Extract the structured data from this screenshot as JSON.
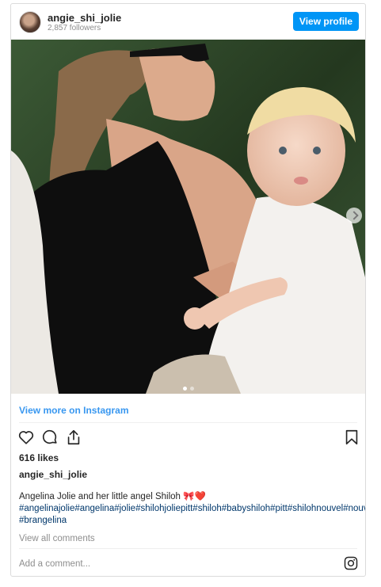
{
  "header": {
    "username": "angie_shi_jolie",
    "followers": "2,857 followers",
    "view_profile": "View profile"
  },
  "photo": {
    "description_icon": "photo-carousel",
    "slide_count": 2,
    "active_slide": 1
  },
  "links": {
    "view_more": "View more on Instagram"
  },
  "actions": {
    "icons": [
      "heart-icon",
      "comment-icon",
      "share-icon",
      "bookmark-icon"
    ]
  },
  "post": {
    "likes": "616 likes",
    "owner": "angie_shi_jolie",
    "caption_line1": "Angelina Jolie and her little angel Shiloh 🎀❤️",
    "caption_line2": "#angelinajolie#angelina#jolie#shilohjoliepitt#shiloh#babyshiloh#pitt#shilohnouvel#nouvel",
    "caption_line3": "#brangelina",
    "view_all_comments": "View all comments",
    "add_comment": "Add a comment..."
  },
  "colors": {
    "accent": "#0095f6",
    "link": "#3897f0",
    "hashtag": "#00376b"
  }
}
